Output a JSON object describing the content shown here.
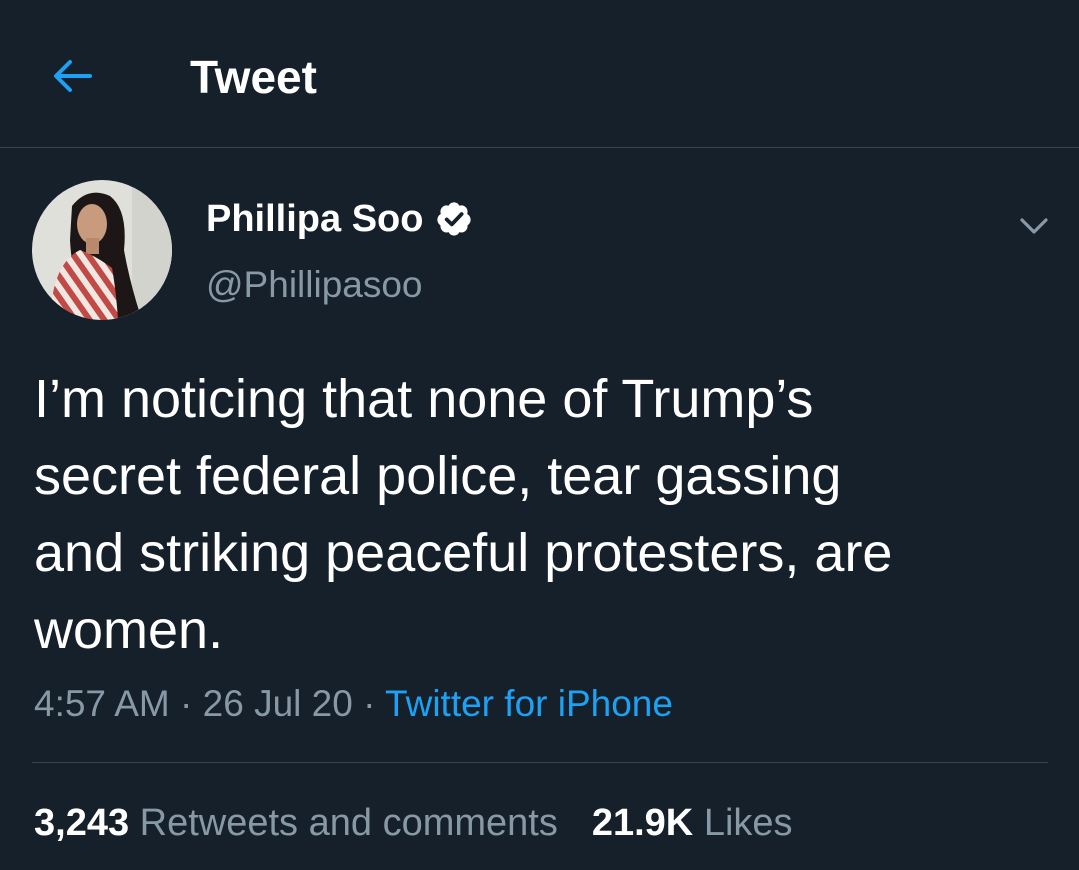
{
  "header": {
    "title": "Tweet",
    "back_icon": "arrow-left-icon"
  },
  "author": {
    "name": "Phillipa Soo",
    "handle": "@Phillipasoo",
    "verified": true,
    "avatar_icon": "profile-photo"
  },
  "tweet": {
    "text": "I’m noticing that none of Trump’s\nsecret federal police, tear gassing\nand striking peaceful protesters, are\nwomen.",
    "time": "4:57 AM",
    "date": "26 Jul 20",
    "source": "Twitter for iPhone",
    "separator": " · "
  },
  "stats": {
    "retweets_count": "3,243",
    "retweets_label": "Retweets and comments",
    "likes_count": "21.9K",
    "likes_label": "Likes"
  },
  "colors": {
    "background": "#15202b",
    "accent": "#1da1f2",
    "muted_text": "#8899a6",
    "border": "#38444d",
    "text": "#ffffff"
  }
}
